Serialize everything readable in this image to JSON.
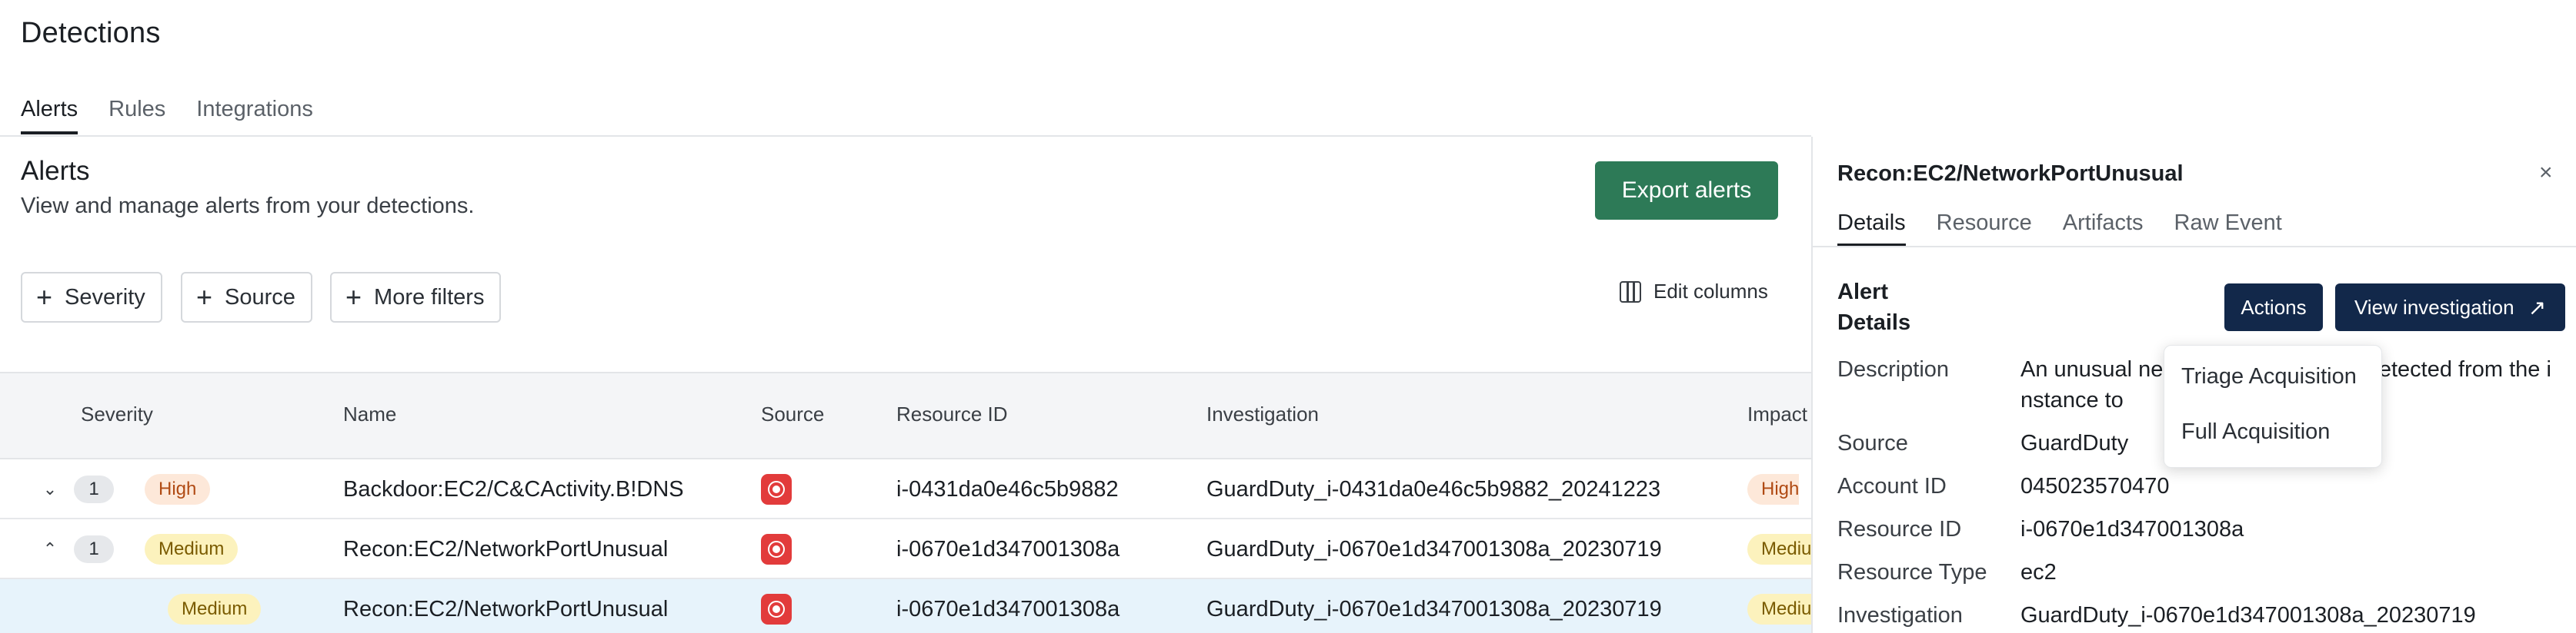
{
  "page": {
    "title": "Detections"
  },
  "top_tabs": [
    {
      "label": "Alerts",
      "active": true
    },
    {
      "label": "Rules",
      "active": false
    },
    {
      "label": "Integrations",
      "active": false
    }
  ],
  "section": {
    "title": "Alerts",
    "subtitle": "View and manage alerts from your detections.",
    "export_label": "Export alerts"
  },
  "filters": {
    "severity": "Severity",
    "source": "Source",
    "more": "More filters",
    "edit_columns": "Edit columns"
  },
  "table": {
    "columns": {
      "severity": "Severity",
      "name": "Name",
      "source": "Source",
      "resource_id": "Resource ID",
      "investigation": "Investigation",
      "impact": "Impact"
    },
    "rows": [
      {
        "count": "1",
        "severity": "High",
        "name": "Backdoor:EC2/C&CActivity.B!DNS",
        "source_icon": "guardduty-icon",
        "resource_id": "i-0431da0e46c5b9882",
        "investigation": "GuardDuty_i-0431da0e46c5b9882_20241223",
        "impact": "High"
      },
      {
        "count": "1",
        "severity": "Medium",
        "name": "Recon:EC2/NetworkPortUnusual",
        "source_icon": "guardduty-icon",
        "resource_id": "i-0670e1d347001308a",
        "investigation": "GuardDuty_i-0670e1d347001308a_20230719",
        "impact": "Mediu"
      },
      {
        "severity": "Medium",
        "name": "Recon:EC2/NetworkPortUnusual",
        "source_icon": "guardduty-icon",
        "resource_id": "i-0670e1d347001308a",
        "investigation": "GuardDuty_i-0670e1d347001308a_20230719",
        "impact": "Mediu"
      }
    ]
  },
  "panel": {
    "title": "Recon:EC2/NetworkPortUnusual",
    "close": "×",
    "tabs": [
      {
        "label": "Details",
        "active": true
      },
      {
        "label": "Resource",
        "active": false
      },
      {
        "label": "Artifacts",
        "active": false
      },
      {
        "label": "Raw Event",
        "active": false
      }
    ],
    "section_label_1": "Alert",
    "section_label_2": "Details",
    "actions_label": "Actions",
    "view_label": "View investigation",
    "view_arrow": "↗",
    "fields": {
      "description_label": "Description",
      "description_value": "An unusual ne                              s detected from the instance to",
      "source_label": "Source",
      "source_value": "GuardDuty",
      "account_label": "Account ID",
      "account_value": "045023570470",
      "resource_id_label": "Resource ID",
      "resource_id_value": "i-0670e1d347001308a",
      "resource_type_label": "Resource Type",
      "resource_type_value": "ec2",
      "investigation_label": "Investigation",
      "investigation_value": "GuardDuty_i-0670e1d347001308a_20230719"
    }
  },
  "dropdown": {
    "items": [
      "Triage Acquisition",
      "Full Acquisition"
    ]
  },
  "colors": {
    "export_button": "#2d7a57",
    "primary_dark": "#12284a",
    "selected_row": "#e7f3fb",
    "high_badge_bg": "#fde8d9",
    "medium_badge_bg": "#fcf2bd",
    "source_icon": "#e23b3b"
  }
}
